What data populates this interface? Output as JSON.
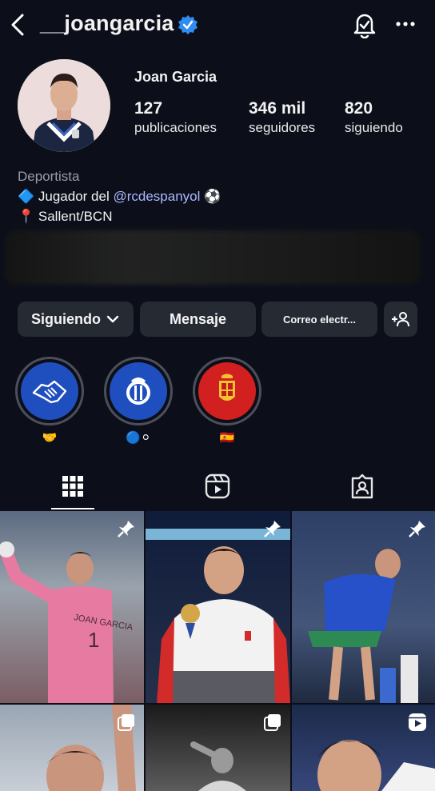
{
  "header": {
    "username": "__joangarcia",
    "icons": [
      "back-arrow-icon",
      "verified-badge-icon",
      "notification-bell-icon",
      "more-options-icon"
    ]
  },
  "profile": {
    "display_name": "Joan Garcia",
    "stats": {
      "posts_count": "127",
      "posts_label": "publicaciones",
      "followers_count": "346 mil",
      "followers_label": "seguidores",
      "following_count": "820",
      "following_label": "siguiendo"
    },
    "bio": {
      "category": "Deportista",
      "line1_prefix": "🔷 Jugador del ",
      "line1_mention": "@rcdespanyol",
      "line1_suffix": " ⚽",
      "line2": "📍 Sallent/BCN"
    }
  },
  "actions": {
    "following_label": "Siguiendo",
    "message_label": "Mensaje",
    "email_label": "Correo electr...",
    "add_person_icon": "add-person-icon"
  },
  "highlights": [
    {
      "label": "🤝",
      "icon": "handshake-icon"
    },
    {
      "label": "🔵⚪",
      "icon": "rcd-espanyol-crest-icon"
    },
    {
      "label": "🇪🇸",
      "icon": "spain-crest-icon"
    }
  ],
  "tabs": [
    "grid-tab-icon",
    "reels-tab-icon",
    "tagged-tab-icon"
  ],
  "posts": [
    {
      "badge": "pin-icon"
    },
    {
      "badge": "pin-icon"
    },
    {
      "badge": "pin-icon"
    },
    {
      "badge": "carousel-icon"
    },
    {
      "badge": "carousel-icon"
    },
    {
      "badge": "reel-icon"
    }
  ],
  "colors": {
    "background": "#0c0f1a",
    "button": "#262a33",
    "mention": "#a9b9ff",
    "verified": "#2f8cf0",
    "espanyol_blue": "#1f4fbf",
    "spain_red": "#d21f1f"
  }
}
